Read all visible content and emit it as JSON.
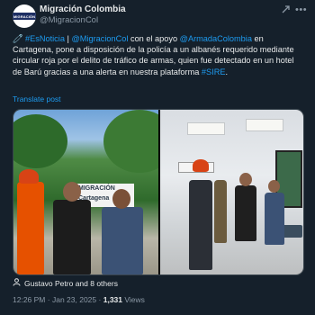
{
  "author": {
    "display_name": "Migración Colombia",
    "handle": "@MigracionCol",
    "avatar_text": "MIGRACIÓN"
  },
  "header_icons": {
    "grok": "grok-icon",
    "more": "more-icon"
  },
  "tweet": {
    "emoji": "🧷",
    "hashtag_es_noticia": "#EsNoticia",
    "separator": "|",
    "mention_migracion": "@MigracionCol",
    "text_1": "con el apoyo",
    "mention_armada": "@ArmadaColombia",
    "text_2": "en Cartagena, pone a disposición de la policía a un albanés requerido mediante circular roja por el delito de tráfico de armas, quien fue detectado en un hotel de Barú gracias a una alerta en nuestra plataforma",
    "hashtag_sire": "#SIRE",
    "text_3": "."
  },
  "translate_label": "Translate post",
  "media": {
    "left_sign_text_1": "MIGRACIÓN",
    "left_sign_text_2": "Cartagena"
  },
  "tagged": "Gustavo Petro and 8 others",
  "meta": {
    "time": "12:26 PM",
    "dot": "·",
    "date": "Jan 23, 2025",
    "views_count": "1,331",
    "views_label": "Views"
  },
  "colors": {
    "background": "#15202b",
    "link": "#1d9bf0",
    "secondary": "#8b98a5"
  }
}
